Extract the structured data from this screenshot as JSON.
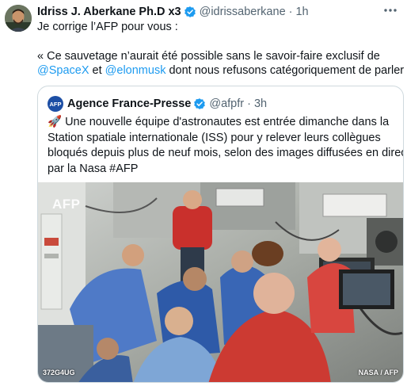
{
  "tweet": {
    "author_name": "Idriss J. Aberkane Ph.D x3",
    "handle": "@idrissaberkane",
    "time": "· 1h",
    "line1": "Je corrige l’AFP pour vous :",
    "line2": "« Ce sauvetage n’aurait été possible sans le savoir-faire exclusif de",
    "mention_spacex": "@SpaceX",
    "and_word": " et ",
    "mention_elon": "@elonmusk",
    "line3_tail": " dont nous refusons catégoriquement de parler »"
  },
  "quote": {
    "logo_text": "AFP",
    "author_name": "Agence France-Presse",
    "handle": "@afpfr",
    "time": "· 3h",
    "text_lines": [
      "🚀 Une nouvelle équipe d'astronautes est entrée dimanche dans la",
      "Station spatiale internationale (ISS) pour y relever leurs collègues",
      "bloqués depuis plus de neuf mois, selon des images diffusées en direct",
      "par la Nasa #AFP"
    ],
    "photo": {
      "watermark": "AFP",
      "label_left": "372G4UG",
      "label_right": "NASA / AFP"
    }
  },
  "colors": {
    "link": "#1d9bf0",
    "verified": "#1d9bf0",
    "muted": "#536471",
    "border": "#cfd9de"
  },
  "icons": [
    "verified-badge-icon",
    "more-options-icon"
  ]
}
